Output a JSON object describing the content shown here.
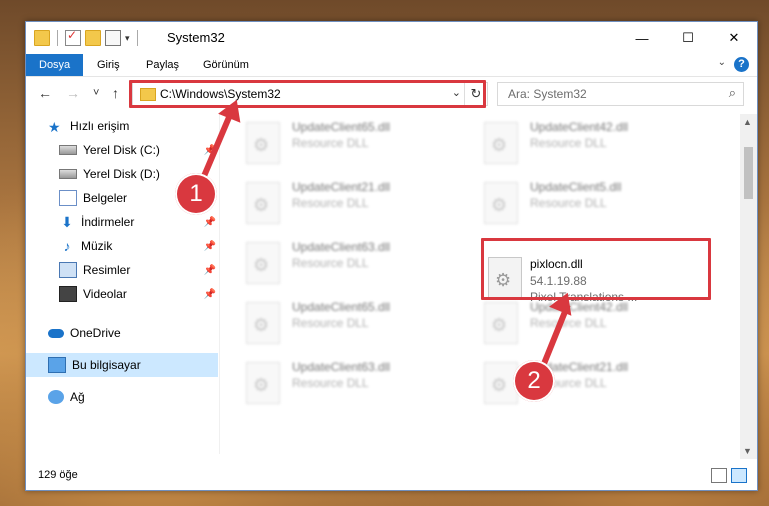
{
  "window": {
    "title": "System32"
  },
  "ribbon": {
    "tabs": [
      "Dosya",
      "Giriş",
      "Paylaş",
      "Görünüm"
    ]
  },
  "nav": {
    "back": "←",
    "forward": "→",
    "recent": "˅",
    "up": "↑",
    "address": "C:\\Windows\\System32",
    "search_placeholder": "Ara: System32"
  },
  "sidebar": {
    "items": [
      {
        "label": "Hızlı erişim",
        "icon": "star-icon"
      },
      {
        "label": "Yerel Disk (C:)",
        "icon": "drive-icon"
      },
      {
        "label": "Yerel Disk (D:)",
        "icon": "drive-icon"
      },
      {
        "label": "Belgeler",
        "icon": "documents-icon"
      },
      {
        "label": "İndirmeler",
        "icon": "downloads-icon"
      },
      {
        "label": "Müzik",
        "icon": "music-icon"
      },
      {
        "label": "Resimler",
        "icon": "pictures-icon"
      },
      {
        "label": "Videolar",
        "icon": "videos-icon"
      },
      {
        "label": "OneDrive",
        "icon": "cloud-icon"
      },
      {
        "label": "Bu bilgisayar",
        "icon": "computer-icon"
      },
      {
        "label": "Ağ",
        "icon": "network-icon"
      }
    ]
  },
  "files": [
    {
      "name": "UpdateClient65.dll",
      "line1": "Resource DLL",
      "line2": ""
    },
    {
      "name": "UpdateClient42.dll",
      "line1": "Resource DLL",
      "line2": ""
    },
    {
      "name": "UpdateClient21.dll",
      "line1": "Resource DLL",
      "line2": ""
    },
    {
      "name": "UpdateClient5.dll",
      "line1": "Resource DLL",
      "line2": ""
    },
    {
      "name": "UpdateClient63.dll",
      "line1": "Resource DLL",
      "line2": ""
    },
    {
      "name": "pixlocn.dll",
      "line1": "54.1.19.88",
      "line2": "Pixel Translations ..."
    },
    {
      "name": "UpdateClient65.dll",
      "line1": "Resource DLL",
      "line2": ""
    },
    {
      "name": "UpdateClient42.dll",
      "line1": "Resource DLL",
      "line2": ""
    },
    {
      "name": "UpdateClient63.dll",
      "line1": "Resource DLL",
      "line2": ""
    },
    {
      "name": "UpdateClient21.dll",
      "line1": "Resource DLL",
      "line2": ""
    }
  ],
  "status": {
    "count": "129 öğe"
  },
  "markers": {
    "one": "1",
    "two": "2"
  },
  "colors": {
    "accent": "#1a73c9",
    "annotation": "#d9383f"
  }
}
